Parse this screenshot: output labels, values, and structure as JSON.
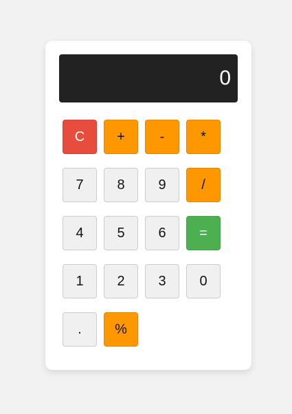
{
  "display": {
    "value": "0"
  },
  "keys": [
    {
      "label": "C",
      "name": "clear-button",
      "kind": "clear"
    },
    {
      "label": "+",
      "name": "add-button",
      "kind": "op"
    },
    {
      "label": "-",
      "name": "subtract-button",
      "kind": "op"
    },
    {
      "label": "*",
      "name": "multiply-button",
      "kind": "op"
    },
    {
      "label": "7",
      "name": "digit-7-button",
      "kind": "digit"
    },
    {
      "label": "8",
      "name": "digit-8-button",
      "kind": "digit"
    },
    {
      "label": "9",
      "name": "digit-9-button",
      "kind": "digit"
    },
    {
      "label": "/",
      "name": "divide-button",
      "kind": "op"
    },
    {
      "label": "4",
      "name": "digit-4-button",
      "kind": "digit"
    },
    {
      "label": "5",
      "name": "digit-5-button",
      "kind": "digit"
    },
    {
      "label": "6",
      "name": "digit-6-button",
      "kind": "digit"
    },
    {
      "label": "=",
      "name": "equals-button",
      "kind": "equals"
    },
    {
      "label": "1",
      "name": "digit-1-button",
      "kind": "digit"
    },
    {
      "label": "2",
      "name": "digit-2-button",
      "kind": "digit"
    },
    {
      "label": "3",
      "name": "digit-3-button",
      "kind": "digit"
    },
    {
      "label": "0",
      "name": "digit-0-button",
      "kind": "digit"
    },
    {
      "label": ".",
      "name": "decimal-button",
      "kind": "digit"
    },
    {
      "label": "%",
      "name": "percent-button",
      "kind": "op"
    }
  ],
  "colors": {
    "background": "#f2f2f2",
    "display": "#222222",
    "operator": "#ff9800",
    "clear": "#e74c3c",
    "equals": "#4caf50",
    "digit": "#f0f0f0"
  }
}
